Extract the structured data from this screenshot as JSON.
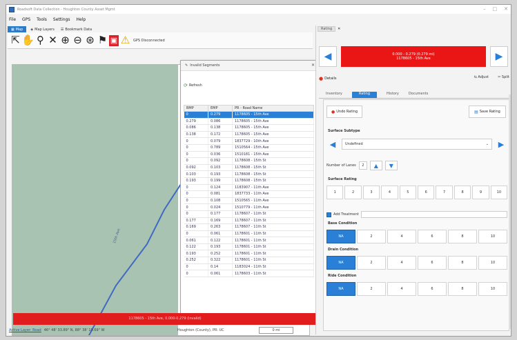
{
  "window": {
    "title": "Roadsoft Data Collection - Houghton County Asset Mgmt",
    "controls": [
      "–",
      "□",
      "✕"
    ]
  },
  "menu": [
    "File",
    "GPS",
    "Tools",
    "Settings",
    "Help"
  ],
  "left_tabs": {
    "map": "Map",
    "layers": "Map Layers",
    "bookmarks": "Bookmark Data"
  },
  "gps_status": "GPS Disconnected",
  "segments_panel": {
    "title": "Invalid Segments",
    "refresh_label": "Refresh",
    "columns": [
      "BMP",
      "EMP",
      "PR - Road Name"
    ],
    "rows": [
      [
        "0",
        "0.279",
        "1178605 - 15th Ave"
      ],
      [
        "0.279",
        "0.086",
        "1178605 - 15th Ave"
      ],
      [
        "0.086",
        "0.138",
        "1178605 - 15th Ave"
      ],
      [
        "0.138",
        "0.172",
        "1178605 - 15th Ave"
      ],
      [
        "0",
        "0.079",
        "1837729 - 10th Ave"
      ],
      [
        "0",
        "0.789",
        "1510564 - 15th Ave"
      ],
      [
        "0",
        "0.036",
        "1510181 - 15th Ave"
      ],
      [
        "0",
        "0.092",
        "1178608 - 15th St"
      ],
      [
        "0.092",
        "0.103",
        "1178608 - 15th St"
      ],
      [
        "0.103",
        "0.193",
        "1178608 - 15th St"
      ],
      [
        "0.193",
        "0.199",
        "1178608 - 15th St"
      ],
      [
        "0",
        "0.124",
        "1183907 - 11th Ave"
      ],
      [
        "0",
        "0.081",
        "1837733 - 11th Ave"
      ],
      [
        "0",
        "0.108",
        "1510565 - 11th Ave"
      ],
      [
        "0",
        "0.024",
        "1510779 - 11th Ave"
      ],
      [
        "0",
        "0.177",
        "1178607 - 11th St"
      ],
      [
        "0.177",
        "0.169",
        "1178607 - 11th St"
      ],
      [
        "0.169",
        "0.263",
        "1178607 - 11th St"
      ],
      [
        "0",
        "0.061",
        "1178601 - 11th St"
      ],
      [
        "0.061",
        "0.122",
        "1178601 - 11th St"
      ],
      [
        "0.122",
        "0.193",
        "1178601 - 11th St"
      ],
      [
        "0.193",
        "0.252",
        "1178601 - 11th St"
      ],
      [
        "0.252",
        "0.322",
        "1178601 - 11th St"
      ],
      [
        "0",
        "0.14",
        "1183024 - 11th St"
      ],
      [
        "0",
        "0.061",
        "1178603 - 11th St"
      ]
    ]
  },
  "map_label": "15th Ave",
  "status_bar": "1178605 - 15th Ave, 0.000-0.279 (Invalid)",
  "footer": {
    "link": "Active Layer: Road",
    "coords": "46° 48' 33.89\" N, 88° 38' 19.69\" W",
    "county": "Houghton (County), PR: UC",
    "scale": "0 mi"
  },
  "right_panel": {
    "tab": "Rating",
    "segment_banner": {
      "line1": "0.000 - 0.279 (0.279 mi)",
      "line2": "1178605 - 15th Ave"
    },
    "details_label": "Details",
    "adjust_label": "Adjust",
    "split_label": "Split",
    "subtabs": [
      "Inventory",
      "Rating",
      "History",
      "Documents"
    ],
    "undo_label": "Undo Rating",
    "save_label": "Save Rating",
    "surface_subtype_label": "Surface Subtype",
    "surface_subtype_value": "Undefined",
    "lanes_label": "Number of Lanes",
    "lanes_value": "2",
    "surface_rating_label": "Surface Rating",
    "surface_ratings": [
      "1",
      "2",
      "3",
      "4",
      "5",
      "6",
      "7",
      "8",
      "9",
      "10"
    ],
    "treatment_label": "Add Treatment",
    "base_label": "Base Condition",
    "drain_label": "Drain Condition",
    "ride_label": "Ride Condition",
    "condition_values": [
      "NA",
      "2",
      "4",
      "6",
      "8",
      "10"
    ]
  }
}
